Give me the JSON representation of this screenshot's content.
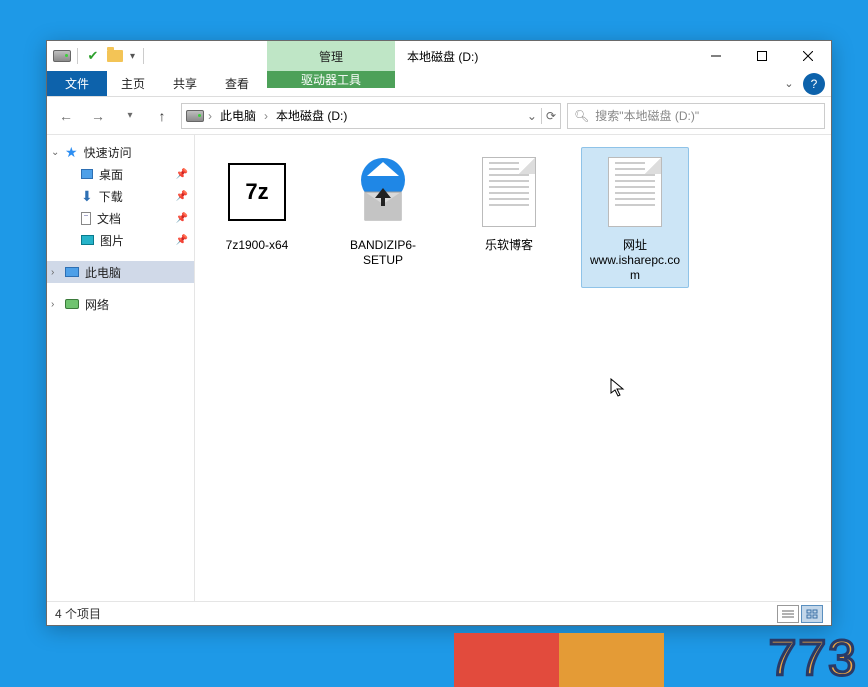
{
  "window": {
    "context_tab_group": "管理",
    "title": "本地磁盘 (D:)"
  },
  "ribbon": {
    "file": "文件",
    "tabs": [
      "主页",
      "共享",
      "查看"
    ],
    "context_tab": "驱动器工具"
  },
  "address": {
    "segments": [
      "此电脑",
      "本地磁盘 (D:)"
    ]
  },
  "search": {
    "placeholder": "搜索\"本地磁盘 (D:)\""
  },
  "nav": {
    "quick_access": "快速访问",
    "quick_items": [
      {
        "label": "桌面",
        "icon": "desktop"
      },
      {
        "label": "下载",
        "icon": "down"
      },
      {
        "label": "文档",
        "icon": "doc"
      },
      {
        "label": "图片",
        "icon": "pic"
      }
    ],
    "this_pc": "此电脑",
    "network": "网络"
  },
  "files": [
    {
      "label": "7z1900-x64",
      "type": "exe-7z",
      "selected": false
    },
    {
      "label": "BANDIZIP6-SETUP",
      "type": "exe-bandizip",
      "selected": false
    },
    {
      "label": "乐软博客",
      "type": "shortcut",
      "selected": false
    },
    {
      "label": "网址www.isharepc.com",
      "type": "shortcut",
      "selected": true
    }
  ],
  "status": {
    "text": "4 个项目"
  },
  "taskbar_number": "773"
}
